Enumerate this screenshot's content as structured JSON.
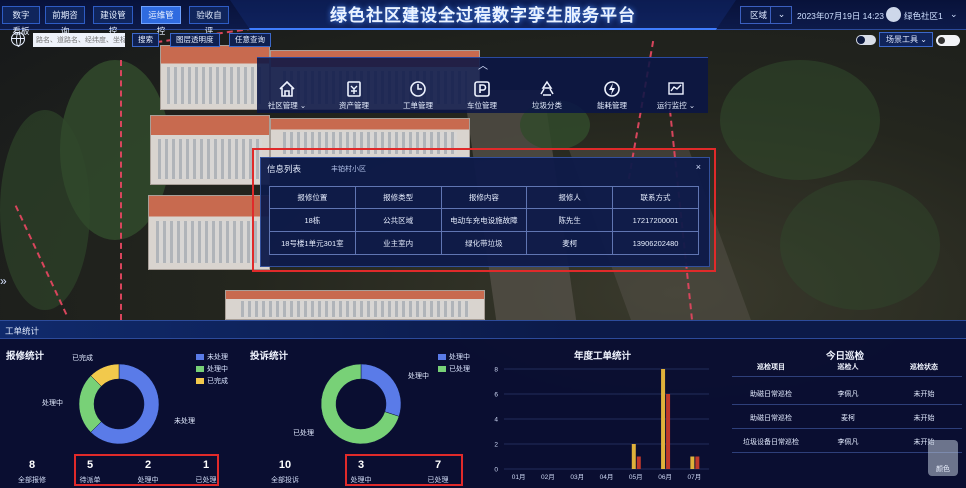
{
  "header": {
    "title": "绿色社区建设全过程数字孪生服务平台",
    "nav": [
      {
        "label": "数字看板",
        "active": false
      },
      {
        "label": "前期咨询",
        "active": false
      },
      {
        "label": "建设管控",
        "active": false
      },
      {
        "label": "运维管控",
        "active": true
      },
      {
        "label": "验收自评",
        "active": false
      }
    ],
    "region_label": "区域",
    "datetime": "2023年07月19日 14:23",
    "community": "绿色社区1"
  },
  "toolbar": {
    "search_placeholder": "路名、道路名、经纬度、坐标",
    "search_button": "搜索",
    "layer_opacity": "图层透明度",
    "free_query": "任意查询",
    "scene_tools": "场景工具"
  },
  "modules": [
    {
      "label": "社区管理",
      "icon": "home-icon"
    },
    {
      "label": "资产管理",
      "icon": "asset-icon"
    },
    {
      "label": "工单管理",
      "icon": "clock-icon"
    },
    {
      "label": "车位管理",
      "icon": "parking-icon"
    },
    {
      "label": "垃圾分类",
      "icon": "recycle-icon"
    },
    {
      "label": "能耗管理",
      "icon": "energy-icon"
    },
    {
      "label": "运行监控",
      "icon": "chart-icon"
    }
  ],
  "scene_label": "丰铂村小区",
  "info_panel": {
    "title": "信息列表",
    "columns": [
      "报修位置",
      "报修类型",
      "报修内容",
      "报修人",
      "联系方式"
    ],
    "rows": [
      [
        "18栋",
        "公共区域",
        "电动车充电设施故障",
        "陈先生",
        "17217200001"
      ],
      [
        "18号楼1单元301室",
        "业主室内",
        "绿化带垃圾",
        "麦柯",
        "13906202480"
      ]
    ]
  },
  "bottom": {
    "header": "工单统计",
    "repair": {
      "title": "报修统计",
      "legend": [
        {
          "label": "未处理",
          "color": "#5a7be8"
        },
        {
          "label": "处理中",
          "color": "#78d177"
        },
        {
          "label": "已完成",
          "color": "#f2c94c"
        }
      ],
      "donut_labels": {
        "done": "已完成",
        "processing": "处理中",
        "pending": "未处理"
      },
      "stats": [
        {
          "value": "8",
          "label": "全部报修"
        },
        {
          "value": "5",
          "label": "待派单"
        },
        {
          "value": "2",
          "label": "处理中"
        },
        {
          "value": "1",
          "label": "已处理"
        }
      ]
    },
    "complaint": {
      "title": "投诉统计",
      "legend": [
        {
          "label": "处理中",
          "color": "#5a7be8"
        },
        {
          "label": "已处理",
          "color": "#78d177"
        }
      ],
      "donut_labels": {
        "processing": "处理中",
        "done": "已处理"
      },
      "stats": [
        {
          "value": "10",
          "label": "全部投诉"
        },
        {
          "value": "3",
          "label": "处理中"
        },
        {
          "value": "7",
          "label": "已处理"
        }
      ]
    },
    "annual": {
      "title": "年度工单统计"
    },
    "patrol": {
      "title": "今日巡检",
      "columns": [
        "巡检项目",
        "巡检人",
        "巡检状态"
      ],
      "rows": [
        [
          "助磁日常巡检",
          "李佩凡",
          "未开始"
        ],
        [
          "助磁日常巡检",
          "麦柯",
          "未开始"
        ],
        [
          "垃圾设备日常巡检",
          "李佩凡",
          "未开始"
        ]
      ]
    }
  },
  "color_fab": "颜色",
  "chart_data": [
    {
      "type": "pie",
      "title": "报修统计",
      "categories": [
        "未处理",
        "处理中",
        "已完成"
      ],
      "values": [
        5,
        2,
        1
      ],
      "colors": [
        "#5a7be8",
        "#78d177",
        "#f2c94c"
      ]
    },
    {
      "type": "pie",
      "title": "投诉统计",
      "categories": [
        "处理中",
        "已处理"
      ],
      "values": [
        3,
        7
      ],
      "colors": [
        "#5a7be8",
        "#78d177"
      ]
    },
    {
      "type": "bar",
      "title": "年度工单统计",
      "categories": [
        "01月",
        "02月",
        "03月",
        "04月",
        "05月",
        "06月",
        "07月"
      ],
      "series": [
        {
          "values": [
            0,
            0,
            0,
            0,
            2,
            8,
            1
          ],
          "color": "#e0b13a"
        },
        {
          "values": [
            0,
            0,
            0,
            0,
            1,
            6,
            1
          ],
          "color": "#c0392b"
        }
      ],
      "ylim": [
        0,
        8
      ],
      "yticks": [
        "0",
        "2",
        "4",
        "6",
        "8"
      ],
      "grid": true
    }
  ]
}
